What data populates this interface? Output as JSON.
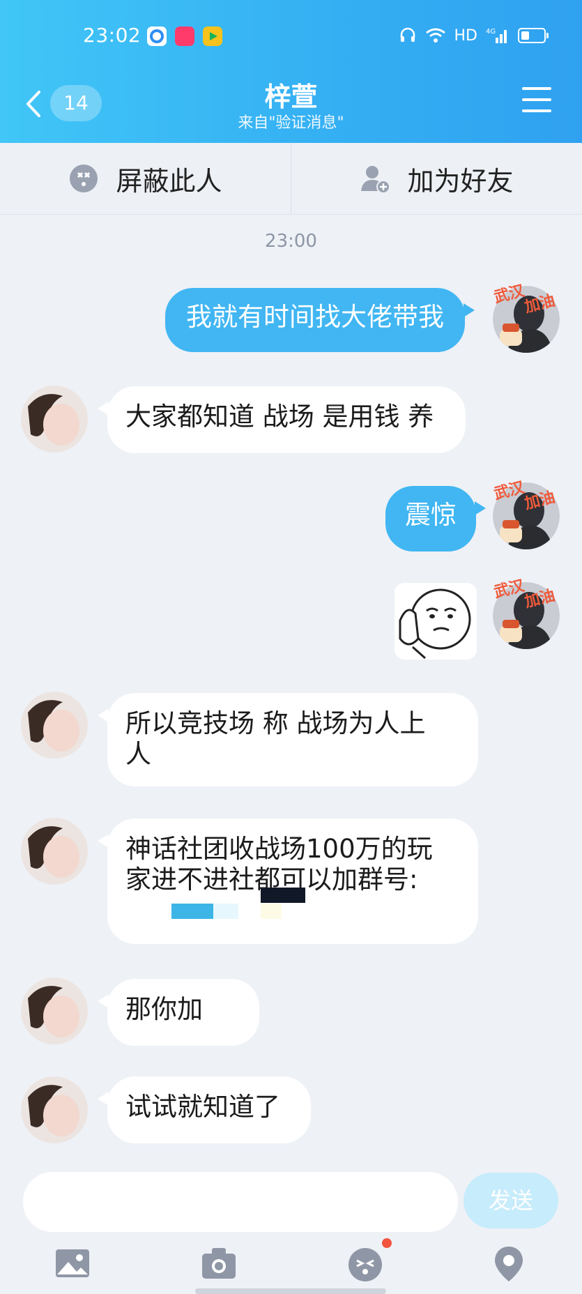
{
  "status_bar": {
    "time": "23:02",
    "network": "HD",
    "signal": "4G",
    "icons": [
      "headset-icon",
      "wifi-icon",
      "signal-icon",
      "battery-icon"
    ]
  },
  "header": {
    "back_count": "14",
    "title": "梓萱",
    "subtitle": "来自\"验证消息\""
  },
  "action_bar": {
    "block_label": "屏蔽此人",
    "add_friend_label": "加为好友"
  },
  "timestamp": "23:00",
  "messages": [
    {
      "from": "me",
      "text": "我就有时间找大佬带我"
    },
    {
      "from": "them",
      "text": "大家都知道 战场 是用钱 养"
    },
    {
      "from": "me",
      "text": "震惊"
    },
    {
      "from": "me",
      "type": "sticker",
      "text": ""
    },
    {
      "from": "them",
      "text_line1": "所以竞技场 称 战场为人上",
      "text_line2": "人"
    },
    {
      "from": "them",
      "text_line1": "神话社团收战场100万的玩",
      "text_line2": "家进不进社都可以加群号:"
    },
    {
      "from": "them",
      "text": "那你加"
    },
    {
      "from": "them",
      "text": "试试就知道了"
    }
  ],
  "my_avatar_sticker_text": {
    "line1": "武汉",
    "line2": "加油"
  },
  "input": {
    "placeholder": "",
    "value": "",
    "send_label": "发送"
  },
  "toolbar": [
    "image-icon",
    "camera-icon",
    "emoji-icon",
    "location-icon"
  ],
  "colors": {
    "header_start": "#41c6f7",
    "header_end": "#2fa1f0",
    "out_bubble": "#41b6f2",
    "send_button": "#c7ecfb",
    "badge_dot": "#f2533f"
  }
}
